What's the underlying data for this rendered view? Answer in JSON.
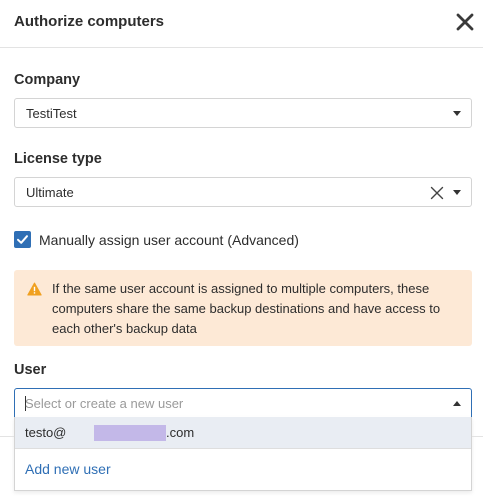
{
  "dialog": {
    "title": "Authorize computers",
    "close_icon": "close-icon"
  },
  "company": {
    "label": "Company",
    "value": "TestiTest",
    "icon": "chevron-down-icon"
  },
  "license_type": {
    "label": "License type",
    "value": "Ultimate",
    "clear_icon": "clear-icon",
    "icon": "chevron-down-icon"
  },
  "manual_assign": {
    "label": "Manually assign user account (Advanced)",
    "checked": true
  },
  "warning": {
    "icon": "warning-icon",
    "text": "If the same user account is assigned to multiple computers, these computers share the same backup destinations and have access to each other's backup data",
    "color": "#fde9d6",
    "icon_color": "#f0a020"
  },
  "user": {
    "label": "User",
    "placeholder": "Select or create a new user",
    "value": "",
    "icon": "chevron-up-icon",
    "options": [
      {
        "prefix": "testo@",
        "suffix": ".com"
      }
    ],
    "add_new_label": "Add new user"
  },
  "colors": {
    "accent": "#2f6fb5",
    "highlight": "#e9edf3",
    "redaction": "#c3b8e8"
  }
}
